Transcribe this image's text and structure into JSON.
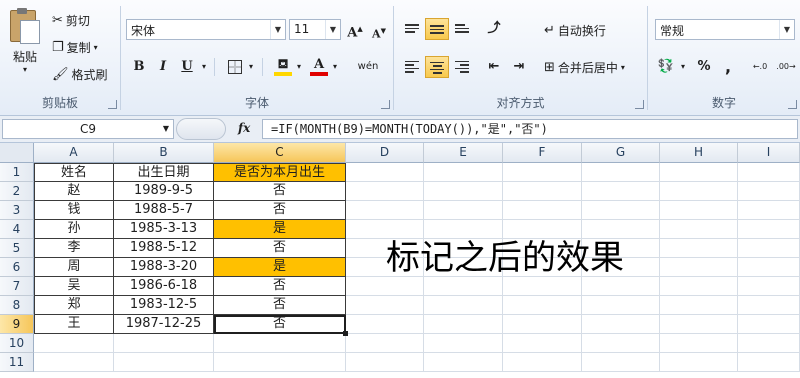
{
  "ribbon": {
    "clipboard": {
      "paste_label": "粘贴",
      "cut_label": "剪切",
      "copy_label": "复制",
      "format_painter_label": "格式刷",
      "group_label": "剪贴板"
    },
    "font": {
      "font_name": "宋体",
      "font_size": "11",
      "bold": "B",
      "italic": "I",
      "underline": "U",
      "grow_glyph": "A",
      "shrink_glyph": "A",
      "phonetic_glyph": "wén",
      "font_color_glyph": "A",
      "group_label": "字体"
    },
    "alignment": {
      "wrap_text_label": "自动换行",
      "merge_center_label": "合并后居中",
      "group_label": "对齐方式"
    },
    "number": {
      "format": "常规",
      "percent_glyph": "%",
      "comma_glyph": ",",
      "increase_decimal_glyph": "←.0",
      "decrease_decimal_glyph": ".00→",
      "group_label": "数字"
    }
  },
  "formula_bar": {
    "name_box": "C9",
    "fx_label": "fx",
    "formula": "=IF(MONTH(B9)=MONTH(TODAY()),\"是\",\"否\")"
  },
  "grid": {
    "columns": [
      "A",
      "B",
      "C",
      "D",
      "E",
      "F",
      "G",
      "H",
      "I"
    ],
    "rows": [
      "1",
      "2",
      "3",
      "4",
      "5",
      "6",
      "7",
      "8",
      "9",
      "10",
      "11"
    ],
    "header_row": {
      "a": "姓名",
      "b": "出生日期",
      "c": "是否为本月出生"
    },
    "data": [
      {
        "name": "赵",
        "date": "1989-9-5",
        "flag": "否"
      },
      {
        "name": "钱",
        "date": "1988-5-7",
        "flag": "否"
      },
      {
        "name": "孙",
        "date": "1985-3-13",
        "flag": "是"
      },
      {
        "name": "李",
        "date": "1988-5-12",
        "flag": "否"
      },
      {
        "name": "周",
        "date": "1988-3-20",
        "flag": "是"
      },
      {
        "name": "吴",
        "date": "1986-6-18",
        "flag": "否"
      },
      {
        "name": "郑",
        "date": "1983-12-5",
        "flag": "否"
      },
      {
        "name": "王",
        "date": "1987-12-25",
        "flag": "否"
      }
    ],
    "highlight_color": "#ffc000"
  },
  "annotation": "标记之后的效果"
}
